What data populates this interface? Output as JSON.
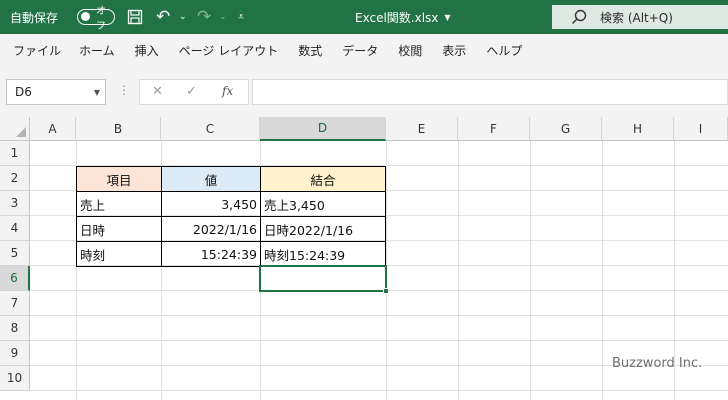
{
  "titlebar": {
    "autosave_label": "自動保存",
    "autosave_state": "オフ",
    "file_name": "Excel関数.xlsx",
    "search_placeholder": "検索 (Alt+Q)",
    "bg_color": "#217346",
    "icons": [
      "save-icon",
      "undo-icon",
      "redo-icon",
      "search-icon"
    ]
  },
  "ribbon": {
    "tabs": [
      "ファイル",
      "ホーム",
      "挿入",
      "ページ レイアウト",
      "数式",
      "データ",
      "校閲",
      "表示",
      "ヘルプ"
    ]
  },
  "formula_bar": {
    "name_box": "D6",
    "fx_label": "fx",
    "formula": ""
  },
  "sheet": {
    "columns": [
      "A",
      "B",
      "C",
      "D",
      "E",
      "F",
      "G",
      "H",
      "I"
    ],
    "rows": [
      "1",
      "2",
      "3",
      "4",
      "5",
      "6",
      "7",
      "8",
      "9",
      "10"
    ],
    "selected_cell": "D6",
    "table": {
      "headers": [
        "項目",
        "値",
        "結合"
      ],
      "header_colors": [
        "#fce4d6",
        "#ddebf7",
        "#fff2cc"
      ],
      "rows": [
        [
          "売上",
          "3,450",
          "売上3,450"
        ],
        [
          "日時",
          "2022/1/16",
          "日時2022/1/16"
        ],
        [
          "時刻",
          "15:24:39",
          "時刻15:24:39"
        ]
      ]
    }
  },
  "watermark": "Buzzword Inc.",
  "accent_color": "#217346"
}
